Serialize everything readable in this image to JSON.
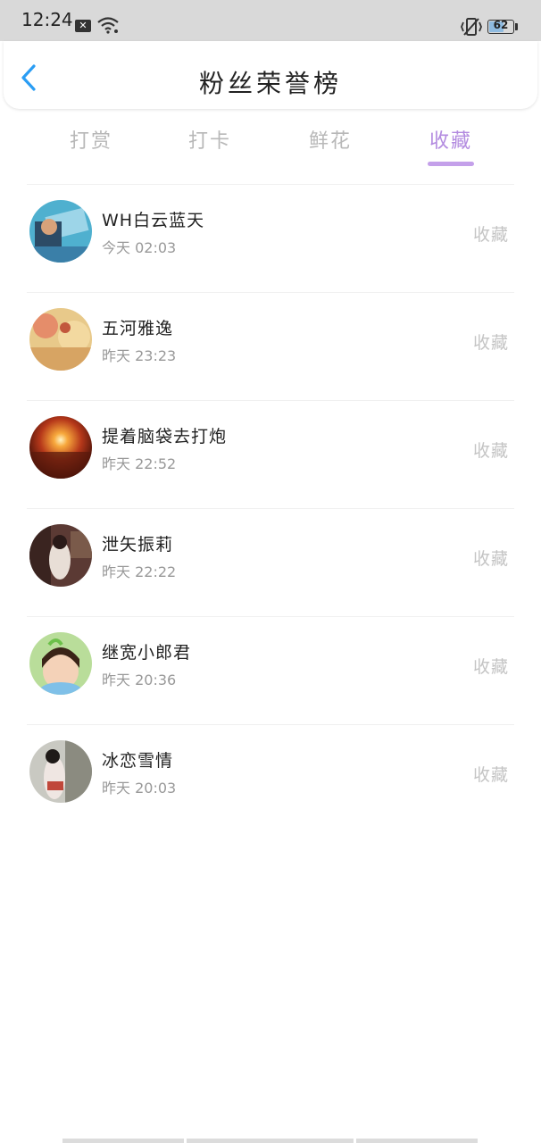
{
  "status_bar": {
    "time": "12:24",
    "notification_icon": "x-box-icon",
    "battery_level": "62",
    "battery_fraction": 0.62
  },
  "header": {
    "title": "粉丝荣誉榜",
    "back_icon": "chevron-left-icon",
    "accent_color": "#2a9df4"
  },
  "tabs": [
    {
      "label": "打赏",
      "active": false
    },
    {
      "label": "打卡",
      "active": false
    },
    {
      "label": "鲜花",
      "active": false
    },
    {
      "label": "收藏",
      "active": true
    }
  ],
  "active_tab_color": "#b38be0",
  "fans": [
    {
      "name": "WH白云蓝天",
      "time": "今天 02:03",
      "action": "收藏"
    },
    {
      "name": "五河雅逸",
      "time": "昨天 23:23",
      "action": "收藏"
    },
    {
      "name": "提着脑袋去打炮",
      "time": "昨天 22:52",
      "action": "收藏"
    },
    {
      "name": "泄矢振莉",
      "time": "昨天 22:22",
      "action": "收藏"
    },
    {
      "name": "继宽小郎君",
      "time": "昨天 20:36",
      "action": "收藏"
    },
    {
      "name": "冰恋雪情",
      "time": "昨天 20:03",
      "action": "收藏"
    }
  ]
}
